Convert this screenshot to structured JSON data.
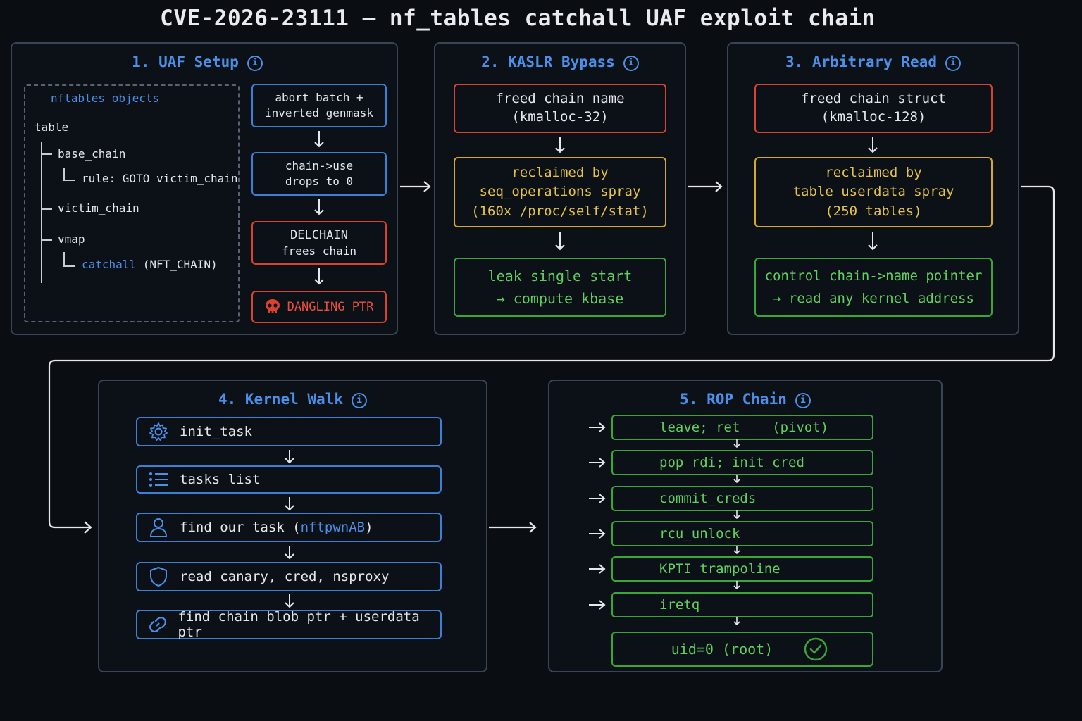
{
  "title": "CVE-2026-23111 — nf_tables catchall UAF exploit chain",
  "info_glyph": "i",
  "colors": {
    "background": "#0a0d12",
    "blue": "#4b8fe8",
    "red": "#d9422f",
    "yellow": "#d6a72a",
    "green": "#3aa53a"
  },
  "panel1": {
    "title": "1. UAF Setup",
    "tree_title": "nftables objects",
    "tree": {
      "table": "table",
      "base_chain": "base_chain",
      "rule": "rule: GOTO victim_chain",
      "victim_chain": "victim_chain",
      "vmap": "vmap",
      "catchall": "catchall",
      "catchall_type": "(NFT_CHAIN)"
    },
    "steps": [
      {
        "line1": "abort batch +",
        "line2": "inverted genmask"
      },
      {
        "line1": "chain->use",
        "line2": "drops to 0"
      },
      {
        "line1": "DELCHAIN",
        "line2": "frees chain"
      }
    ],
    "dangling": "DANGLING PTR",
    "dangling_icon": "skull-icon"
  },
  "panel2": {
    "title": "2. KASLR Bypass",
    "box1": {
      "line1": "freed chain name",
      "line2": "(kmalloc-32)"
    },
    "box2": {
      "line1": "reclaimed by",
      "line2": "seq_operations spray",
      "line3": "(160x /proc/self/stat)"
    },
    "box3": {
      "line1": "leak single_start",
      "line2": "→ compute kbase"
    }
  },
  "panel3": {
    "title": "3. Arbitrary Read",
    "box1": {
      "line1": "freed chain struct",
      "line2": "(kmalloc-128)"
    },
    "box2": {
      "line1": "reclaimed by",
      "line2": "table userdata spray",
      "line3": "(250 tables)"
    },
    "box3": {
      "line1": "control chain->name pointer",
      "line2": "→ read any kernel address"
    }
  },
  "panel4": {
    "title": "4. Kernel Walk",
    "steps": [
      {
        "icon": "gear-icon",
        "text": "init_task"
      },
      {
        "icon": "list-icon",
        "text": "tasks list"
      },
      {
        "icon": "user-icon",
        "text_pre": "find our task (",
        "highlight": "nftpwnAB",
        "text_post": ")"
      },
      {
        "icon": "shield-icon",
        "text": "read canary, cred, nsproxy"
      },
      {
        "icon": "link-icon",
        "text": "find chain blob ptr + userdata ptr"
      }
    ]
  },
  "panel5": {
    "title": "5. ROP Chain",
    "gadgets": [
      "leave; ret    (pivot)",
      "pop rdi; init_cred",
      "commit_creds",
      "rcu_unlock",
      "KPTI trampoline",
      "iretq"
    ],
    "result": "uid=0 (root)",
    "result_icon": "check-circle-icon"
  }
}
